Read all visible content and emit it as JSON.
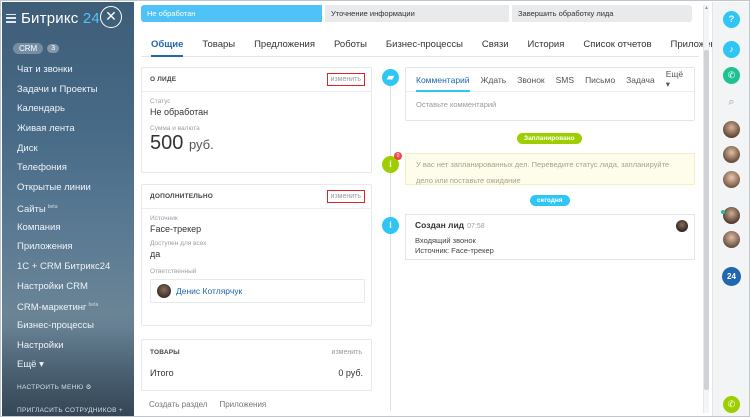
{
  "sidebar": {
    "logo_main": "Битрикс",
    "logo_num": "24",
    "crm_label": "CRM",
    "crm_count": "3",
    "items": [
      {
        "label": "Чат и звонки"
      },
      {
        "label": "Задачи и Проекты"
      },
      {
        "label": "Календарь"
      },
      {
        "label": "Живая лента"
      },
      {
        "label": "Диск"
      },
      {
        "label": "Телефония"
      },
      {
        "label": "Открытые линии"
      },
      {
        "label": "Сайты",
        "sup": "beta"
      },
      {
        "label": "Компания"
      },
      {
        "label": "Приложения"
      },
      {
        "label": "1С + CRM Битрикс24"
      },
      {
        "label": "Настройки CRM"
      },
      {
        "label": "CRM-маркетинг",
        "sup": "beta"
      },
      {
        "label": "Бизнес-процессы"
      },
      {
        "label": "Настройки"
      },
      {
        "label": "Ещё ▾"
      }
    ],
    "setup_menu": "НАСТРОИТЬ МЕНЮ",
    "invite": "ПРИГЛАСИТЬ СОТРУДНИКОВ"
  },
  "stages": [
    {
      "label": "Не обработан",
      "active": true
    },
    {
      "label": "Уточнение информации",
      "active": false
    },
    {
      "label": "Завершить обработку лида",
      "active": false
    }
  ],
  "tabs": [
    {
      "label": "Общие",
      "active": true
    },
    {
      "label": "Товары"
    },
    {
      "label": "Предложения"
    },
    {
      "label": "Роботы"
    },
    {
      "label": "Бизнес-процессы"
    },
    {
      "label": "Связи"
    },
    {
      "label": "История"
    },
    {
      "label": "Список отчетов"
    },
    {
      "label": "Приложения"
    }
  ],
  "about": {
    "title": "О ЛИДЕ",
    "edit": "изменить",
    "status_label": "Статус",
    "status_value": "Не обработан",
    "sum_label": "Сумма и валюта",
    "sum_value": "500",
    "sum_currency": "руб."
  },
  "extra": {
    "title": "ДОПОЛНИТЕЛЬНО",
    "edit": "изменить",
    "source_label": "Источник",
    "source_value": "Face-трекер",
    "available_label": "Доступен для всех",
    "available_value": "да",
    "resp_label": "Ответственный",
    "resp_name": "Денис Котлярчук"
  },
  "products": {
    "title": "ТОВАРЫ",
    "edit": "изменить",
    "total_label": "Итого",
    "total_value": "0 руб."
  },
  "footer": {
    "create_section": "Создать раздел",
    "apps": "Приложения"
  },
  "composer": {
    "tabs": [
      "Комментарий",
      "Ждать",
      "Звонок",
      "SMS",
      "Письмо",
      "Задача"
    ],
    "more": "Ещё ▾",
    "placeholder": "Оставьте комментарий"
  },
  "planned": {
    "label": "Запланировано",
    "badge": "0",
    "text_line1": "У вас нет запланированных дел. Переведите статус лида, запланируйте",
    "text_line2": "дело или поставьте ожидание"
  },
  "today": {
    "label": "сегодня",
    "event_title": "Создан лид",
    "event_time": "07:58",
    "event_line1": "Входящий звонок",
    "event_line2": "Источник: Face-трекер"
  },
  "right_panel": {
    "help": "?",
    "b24": "24"
  },
  "colors": {
    "accent": "#2fc6f6",
    "link": "#2067b0",
    "green": "#9dcf00",
    "edit_highlight": "#e0222a"
  }
}
